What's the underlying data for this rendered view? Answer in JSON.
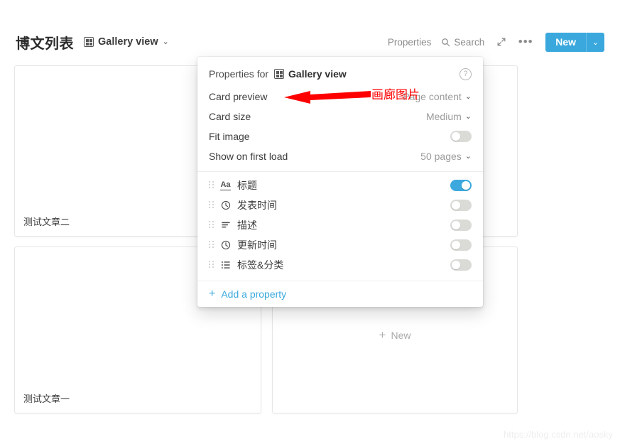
{
  "header": {
    "page_title": "博文列表",
    "view_chip": {
      "icon": "gallery-view-icon",
      "label": "Gallery view",
      "caret": "⌄"
    },
    "properties_label": "Properties",
    "search": {
      "icon": "search-icon",
      "label": "Search"
    },
    "expand_icon": "expand-diagonal-icon",
    "more_icon": "more-horizontal-icon",
    "new_button": {
      "label": "New",
      "caret": "⌄",
      "color": "#3aa8dd"
    }
  },
  "gallery": {
    "cards": [
      {
        "title": "测试文章二"
      },
      {
        "title": ""
      },
      {
        "title": "测试文章一"
      }
    ],
    "new_card": {
      "plus": "+",
      "label": "New"
    }
  },
  "popup": {
    "header": {
      "prefix": "Properties for",
      "view_icon": "gallery-view-icon",
      "view_name": "Gallery view",
      "help_icon": "help-circle-icon",
      "help_glyph": "?"
    },
    "options": [
      {
        "label": "Card preview",
        "value": "Page content",
        "type": "select",
        "caret": "⌄"
      },
      {
        "label": "Card size",
        "value": "Medium",
        "type": "select",
        "caret": "⌄"
      },
      {
        "label": "Fit image",
        "value": "",
        "type": "toggle",
        "on": false
      },
      {
        "label": "Show on first load",
        "value": "50 pages",
        "type": "select",
        "caret": "⌄"
      }
    ],
    "properties": [
      {
        "icon": "text-aa-icon",
        "glyph": "Aa",
        "label": "标题",
        "on": true
      },
      {
        "icon": "clock-icon",
        "glyph": "",
        "label": "发表时间",
        "on": false
      },
      {
        "icon": "text-lines-icon",
        "glyph": "",
        "label": "描述",
        "on": false
      },
      {
        "icon": "clock-icon",
        "glyph": "",
        "label": "更新时间",
        "on": false
      },
      {
        "icon": "list-icon",
        "glyph": "",
        "label": "标签&分类",
        "on": false
      }
    ],
    "footer": {
      "plus": "+",
      "label": "Add a property"
    }
  },
  "annotation": {
    "text": "画廊图片",
    "color": "#ff0000",
    "arrow": "left-arrow"
  },
  "watermark": {
    "text": "https://blog.csdn.net/aosky"
  },
  "colors": {
    "accent": "#3aa8dd",
    "toggle_on": "#3ca8dd",
    "toggle_off": "#dadad6",
    "annotation_red": "#ff0000"
  }
}
